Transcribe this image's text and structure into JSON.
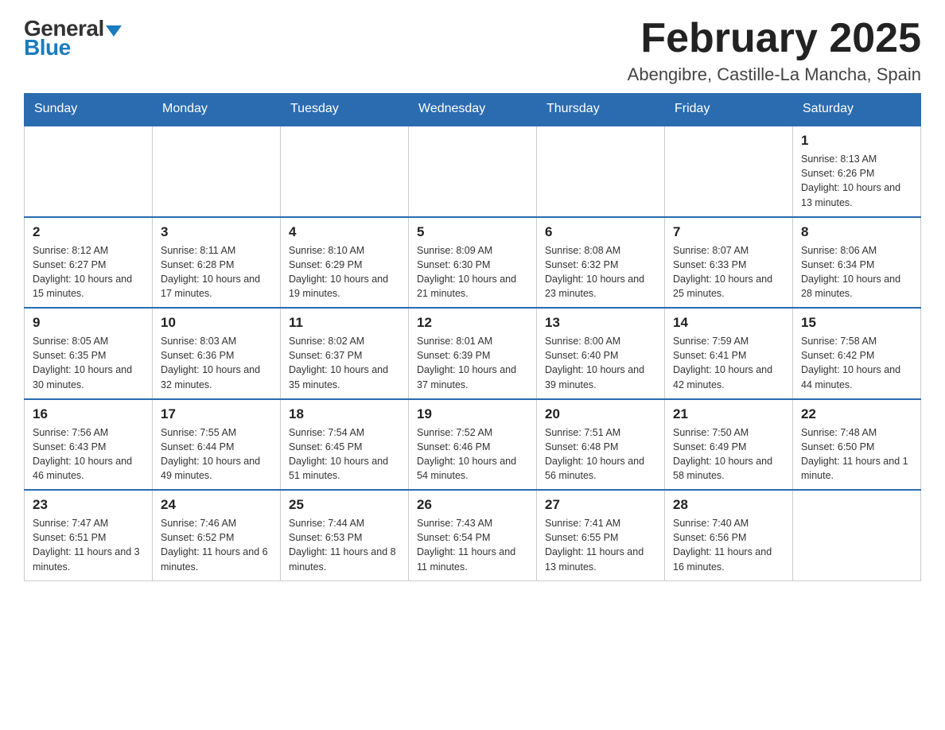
{
  "logo": {
    "general": "General",
    "blue": "Blue"
  },
  "header": {
    "title": "February 2025",
    "location": "Abengibre, Castille-La Mancha, Spain"
  },
  "weekdays": [
    "Sunday",
    "Monday",
    "Tuesday",
    "Wednesday",
    "Thursday",
    "Friday",
    "Saturday"
  ],
  "weeks": [
    [
      {
        "day": "",
        "info": ""
      },
      {
        "day": "",
        "info": ""
      },
      {
        "day": "",
        "info": ""
      },
      {
        "day": "",
        "info": ""
      },
      {
        "day": "",
        "info": ""
      },
      {
        "day": "",
        "info": ""
      },
      {
        "day": "1",
        "info": "Sunrise: 8:13 AM\nSunset: 6:26 PM\nDaylight: 10 hours and 13 minutes."
      }
    ],
    [
      {
        "day": "2",
        "info": "Sunrise: 8:12 AM\nSunset: 6:27 PM\nDaylight: 10 hours and 15 minutes."
      },
      {
        "day": "3",
        "info": "Sunrise: 8:11 AM\nSunset: 6:28 PM\nDaylight: 10 hours and 17 minutes."
      },
      {
        "day": "4",
        "info": "Sunrise: 8:10 AM\nSunset: 6:29 PM\nDaylight: 10 hours and 19 minutes."
      },
      {
        "day": "5",
        "info": "Sunrise: 8:09 AM\nSunset: 6:30 PM\nDaylight: 10 hours and 21 minutes."
      },
      {
        "day": "6",
        "info": "Sunrise: 8:08 AM\nSunset: 6:32 PM\nDaylight: 10 hours and 23 minutes."
      },
      {
        "day": "7",
        "info": "Sunrise: 8:07 AM\nSunset: 6:33 PM\nDaylight: 10 hours and 25 minutes."
      },
      {
        "day": "8",
        "info": "Sunrise: 8:06 AM\nSunset: 6:34 PM\nDaylight: 10 hours and 28 minutes."
      }
    ],
    [
      {
        "day": "9",
        "info": "Sunrise: 8:05 AM\nSunset: 6:35 PM\nDaylight: 10 hours and 30 minutes."
      },
      {
        "day": "10",
        "info": "Sunrise: 8:03 AM\nSunset: 6:36 PM\nDaylight: 10 hours and 32 minutes."
      },
      {
        "day": "11",
        "info": "Sunrise: 8:02 AM\nSunset: 6:37 PM\nDaylight: 10 hours and 35 minutes."
      },
      {
        "day": "12",
        "info": "Sunrise: 8:01 AM\nSunset: 6:39 PM\nDaylight: 10 hours and 37 minutes."
      },
      {
        "day": "13",
        "info": "Sunrise: 8:00 AM\nSunset: 6:40 PM\nDaylight: 10 hours and 39 minutes."
      },
      {
        "day": "14",
        "info": "Sunrise: 7:59 AM\nSunset: 6:41 PM\nDaylight: 10 hours and 42 minutes."
      },
      {
        "day": "15",
        "info": "Sunrise: 7:58 AM\nSunset: 6:42 PM\nDaylight: 10 hours and 44 minutes."
      }
    ],
    [
      {
        "day": "16",
        "info": "Sunrise: 7:56 AM\nSunset: 6:43 PM\nDaylight: 10 hours and 46 minutes."
      },
      {
        "day": "17",
        "info": "Sunrise: 7:55 AM\nSunset: 6:44 PM\nDaylight: 10 hours and 49 minutes."
      },
      {
        "day": "18",
        "info": "Sunrise: 7:54 AM\nSunset: 6:45 PM\nDaylight: 10 hours and 51 minutes."
      },
      {
        "day": "19",
        "info": "Sunrise: 7:52 AM\nSunset: 6:46 PM\nDaylight: 10 hours and 54 minutes."
      },
      {
        "day": "20",
        "info": "Sunrise: 7:51 AM\nSunset: 6:48 PM\nDaylight: 10 hours and 56 minutes."
      },
      {
        "day": "21",
        "info": "Sunrise: 7:50 AM\nSunset: 6:49 PM\nDaylight: 10 hours and 58 minutes."
      },
      {
        "day": "22",
        "info": "Sunrise: 7:48 AM\nSunset: 6:50 PM\nDaylight: 11 hours and 1 minute."
      }
    ],
    [
      {
        "day": "23",
        "info": "Sunrise: 7:47 AM\nSunset: 6:51 PM\nDaylight: 11 hours and 3 minutes."
      },
      {
        "day": "24",
        "info": "Sunrise: 7:46 AM\nSunset: 6:52 PM\nDaylight: 11 hours and 6 minutes."
      },
      {
        "day": "25",
        "info": "Sunrise: 7:44 AM\nSunset: 6:53 PM\nDaylight: 11 hours and 8 minutes."
      },
      {
        "day": "26",
        "info": "Sunrise: 7:43 AM\nSunset: 6:54 PM\nDaylight: 11 hours and 11 minutes."
      },
      {
        "day": "27",
        "info": "Sunrise: 7:41 AM\nSunset: 6:55 PM\nDaylight: 11 hours and 13 minutes."
      },
      {
        "day": "28",
        "info": "Sunrise: 7:40 AM\nSunset: 6:56 PM\nDaylight: 11 hours and 16 minutes."
      },
      {
        "day": "",
        "info": ""
      }
    ]
  ]
}
